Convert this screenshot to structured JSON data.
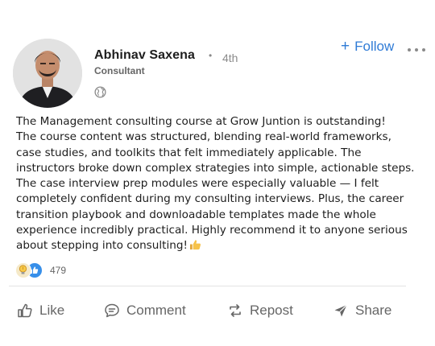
{
  "author": {
    "name": "Abhinav Saxena",
    "connection_degree": "4th",
    "headline": "Consultant",
    "visibility_icon": "globe-icon"
  },
  "follow_button": {
    "label": "Follow",
    "icon": "plus-icon"
  },
  "more_button": {
    "icon": "more-options-icon"
  },
  "post": {
    "paragraphs": [
      "The Management consulting course at Grow Juntion is outstanding!",
      "The course content was  structured, blending real-world frameworks, case studies, and toolkits that felt immediately applicable. The instructors broke down complex strategies into simple, actionable steps. The case interview prep modules were especially valuable — I felt completely confident during my consulting interviews. Plus, the career transition playbook and downloadable templates made the whole experience incredibly practical. Highly recommend it to anyone serious about stepping into consulting!"
    ],
    "trailing_emoji": "thumbs-up-emoji"
  },
  "reactions": {
    "icons": [
      "insightful-bulb-icon",
      "like-thumb-icon"
    ],
    "count": "479"
  },
  "actions": {
    "like": "Like",
    "comment": "Comment",
    "repost": "Repost",
    "share": "Share"
  },
  "colors": {
    "accent": "#2f7bd6",
    "like_reaction": "#378fe9",
    "muted_text": "#666666"
  }
}
